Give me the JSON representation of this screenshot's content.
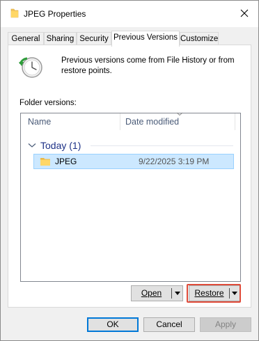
{
  "window": {
    "title": "JPEG Properties"
  },
  "tabs": [
    {
      "label": "General",
      "active": false
    },
    {
      "label": "Sharing",
      "active": false
    },
    {
      "label": "Security",
      "active": false
    },
    {
      "label": "Previous Versions",
      "active": true
    },
    {
      "label": "Customize",
      "active": false
    }
  ],
  "info": {
    "text": "Previous versions come from File History or from restore points."
  },
  "folder_versions": {
    "label": "Folder versions:",
    "columns": [
      "Name",
      "Date modified"
    ],
    "group": {
      "label": "Today (1)"
    },
    "items": [
      {
        "name": "JPEG",
        "date_modified": "9/22/2025 3:19 PM",
        "selected": true
      }
    ]
  },
  "actions": {
    "open_label": "Open",
    "restore_label": "Restore"
  },
  "dialog_buttons": {
    "ok": "OK",
    "cancel": "Cancel",
    "apply": "Apply"
  },
  "colors": {
    "highlight": "#e04b3a",
    "selection": "#cce8ff",
    "group_text": "#1e3287"
  }
}
